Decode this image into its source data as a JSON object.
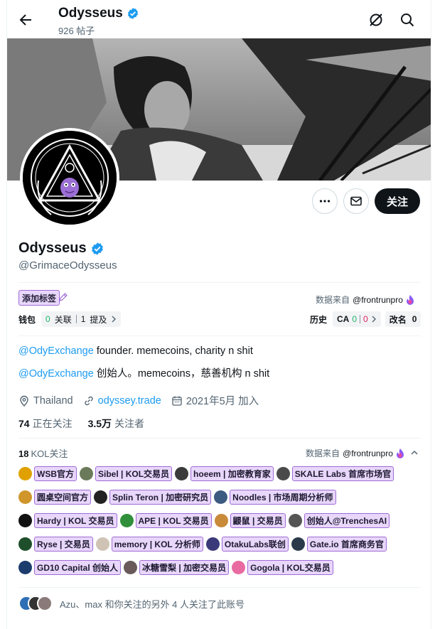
{
  "header": {
    "name": "Odysseus",
    "post_count": "926 帖子"
  },
  "profile": {
    "name": "Odysseus",
    "handle": "@GrimaceOdysseus",
    "follow_label": "关注"
  },
  "plugin": {
    "add_tag_label": "添加标签",
    "source_prefix": "数据来自",
    "source_name": "@frontrunpro",
    "wallet_label": "钱包",
    "wallet_linked_count": "0",
    "wallet_linked_label": "关联",
    "wallet_mention_count": "1",
    "wallet_mention_label": "提及",
    "history_label": "历史",
    "ca_label": "CA",
    "ca_green": "0",
    "ca_red": "0",
    "rename_label": "改名",
    "rename_count": "0"
  },
  "bio": {
    "line1_mention": "@OdyExchange",
    "line1_text": " founder. memecoins, charity n shit",
    "line2_mention": "@OdyExchange",
    "line2_text": " 创始人。memecoins，慈善机构 n shit"
  },
  "meta": {
    "location": "Thailand",
    "website": "odyssey.trade",
    "joined": "2021年5月 加入"
  },
  "stats": {
    "following_count": "74",
    "following_label": "正在关注",
    "followers_count": "3.5万",
    "followers_label": "关注者"
  },
  "kol": {
    "count": "18",
    "label": "KOL关注",
    "source_prefix": "数据来自",
    "source_name": "@frontrunpro",
    "rows": [
      [
        {
          "label": "WSB官方",
          "color": "#e0a100"
        },
        {
          "label": "Sibel | KOL交易员",
          "color": "#6b7a5a"
        },
        {
          "label": "hoeem | 加密教育家",
          "color": "#3b3b3b"
        },
        {
          "label": "SKALE Labs 首席市场官",
          "color": "#4a4a4a"
        }
      ],
      [
        {
          "label": "圆桌空间官方",
          "color": "#d0962b"
        },
        {
          "label": "Splin Teron | 加密研究员",
          "color": "#222222"
        },
        {
          "label": "Noodles | 市场周期分析师",
          "color": "#3d5a80"
        }
      ],
      [
        {
          "label": "Hardy | KOL 交易员",
          "color": "#111111"
        },
        {
          "label": "APE | KOL 交易员",
          "color": "#2f8f3a"
        },
        {
          "label": "鼹鼠 | 交易员",
          "color": "#c98a3a"
        },
        {
          "label": "创始人@TrenchesAI",
          "color": "#555555"
        }
      ],
      [
        {
          "label": "Ryse | 交易员",
          "color": "#1f4f2a"
        },
        {
          "label": "memory | KOL 分析师",
          "color": "#cfc3b5"
        },
        {
          "label": "OtakuLabs联创",
          "color": "#3a3a7a"
        },
        {
          "label": "Gate.io 首席商务官",
          "color": "#2a3a4a"
        }
      ],
      [
        {
          "label": "GD10 Capital 创始人",
          "color": "#1d3c6e"
        },
        {
          "label": "冰糖雪梨 | 加密交易员",
          "color": "#6a5a5a"
        },
        {
          "label": "Gogola | KOL交易员",
          "color": "#e86aa0"
        }
      ]
    ]
  },
  "followers_you_know": {
    "text": "Azu、max 和你关注的另外 4 人关注了此账号"
  }
}
